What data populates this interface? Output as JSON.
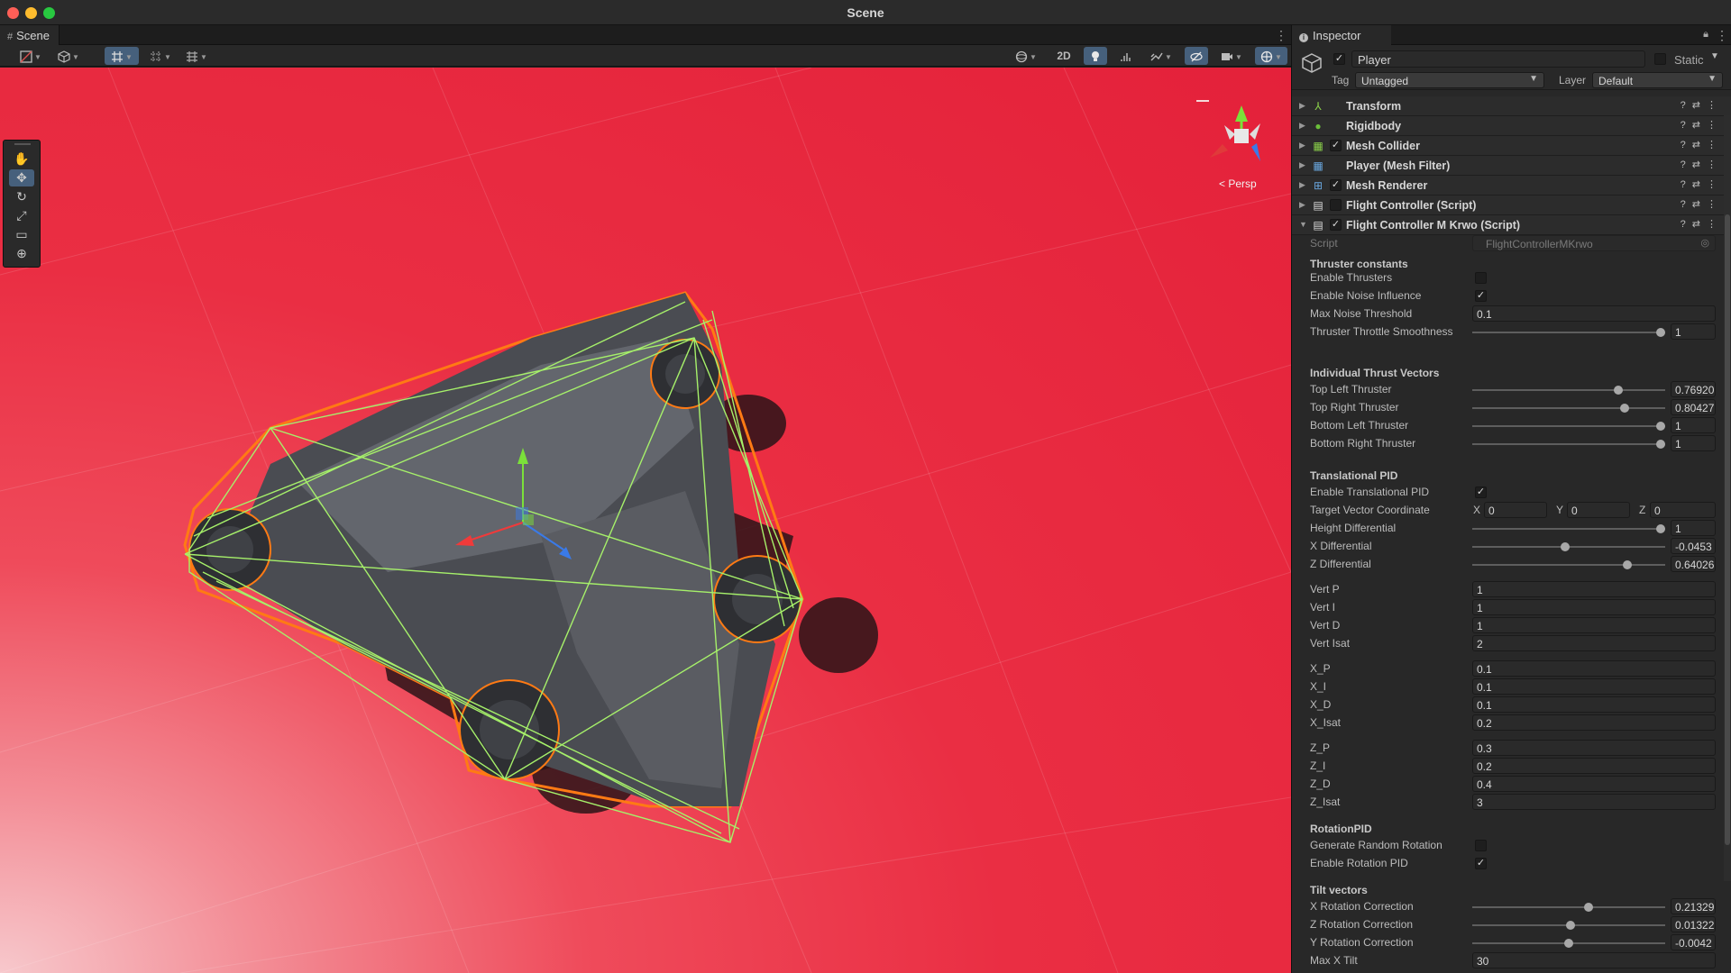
{
  "window": {
    "title": "Scene"
  },
  "scene": {
    "tab_label": "Scene",
    "toolbar": {
      "mode_2d": "2D"
    },
    "gizmo_label": "< Persp"
  },
  "inspector": {
    "tab_label": "Inspector",
    "object": {
      "name": "Player",
      "static_label": "Static",
      "tag_label": "Tag",
      "tag_value": "Untagged",
      "layer_label": "Layer",
      "layer_value": "Default"
    },
    "components": [
      {
        "name": "Transform",
        "icon": "transform-icon",
        "enabled": null
      },
      {
        "name": "Rigidbody",
        "icon": "rigidbody-icon",
        "enabled": null
      },
      {
        "name": "Mesh Collider",
        "icon": "mesh-collider-icon",
        "enabled": true
      },
      {
        "name": "Player (Mesh Filter)",
        "icon": "mesh-filter-icon",
        "enabled": null
      },
      {
        "name": "Mesh Renderer",
        "icon": "mesh-renderer-icon",
        "enabled": true
      },
      {
        "name": "Flight Controller (Script)",
        "icon": "script-icon",
        "enabled": false
      },
      {
        "name": "Flight Controller M Krwo (Script)",
        "icon": "script-icon",
        "enabled": true
      }
    ],
    "script": {
      "label": "Script",
      "value": "FlightControllerMKrwo"
    },
    "sections": {
      "thruster_constants": "Thruster constants",
      "individual_thrust": "Individual Thrust Vectors",
      "translational_pid": "Translational PID",
      "rotation_pid": "RotationPID",
      "tilt_vectors": "Tilt vectors"
    },
    "props": {
      "enable_thrusters": {
        "label": "Enable Thrusters",
        "checked": false
      },
      "enable_noise": {
        "label": "Enable Noise Influence",
        "checked": true
      },
      "max_noise": {
        "label": "Max Noise Threshold",
        "value": "0.1"
      },
      "throttle_smooth": {
        "label": "Thruster Throttle Smoothness",
        "value": "1",
        "fraction": 1.0
      },
      "top_left": {
        "label": "Top Left Thruster",
        "value": "0.76920",
        "fraction": 0.7692
      },
      "top_right": {
        "label": "Top Right Thruster",
        "value": "0.80427",
        "fraction": 0.8043
      },
      "bottom_left": {
        "label": "Bottom Left Thruster",
        "value": "1",
        "fraction": 1.0
      },
      "bottom_right": {
        "label": "Bottom Right Thruster",
        "value": "1",
        "fraction": 1.0
      },
      "enable_translational": {
        "label": "Enable Translational PID",
        "checked": true
      },
      "target_vector": {
        "label": "Target Vector Coordinate",
        "x_label": "X",
        "x": "0",
        "y_label": "Y",
        "y": "0",
        "z_label": "Z",
        "z": "0"
      },
      "height_diff": {
        "label": "Height Differential",
        "value": "1",
        "fraction": 1.0
      },
      "x_diff": {
        "label": "X Differential",
        "value": "-0.0453",
        "fraction": 0.48
      },
      "z_diff": {
        "label": "Z Differential",
        "value": "0.64026",
        "fraction": 0.82
      },
      "vert_p": {
        "label": "Vert P",
        "value": "1"
      },
      "vert_i": {
        "label": "Vert I",
        "value": "1"
      },
      "vert_d": {
        "label": "Vert D",
        "value": "1"
      },
      "vert_isat": {
        "label": "Vert Isat",
        "value": "2"
      },
      "x_p": {
        "label": "X_P",
        "value": "0.1"
      },
      "x_i": {
        "label": "X_I",
        "value": "0.1"
      },
      "x_d": {
        "label": "X_D",
        "value": "0.1"
      },
      "x_isat": {
        "label": "X_Isat",
        "value": "0.2"
      },
      "z_p": {
        "label": "Z_P",
        "value": "0.3"
      },
      "z_i": {
        "label": "Z_I",
        "value": "0.2"
      },
      "z_d": {
        "label": "Z_D",
        "value": "0.4"
      },
      "z_isat": {
        "label": "Z_Isat",
        "value": "3"
      },
      "gen_random_rot": {
        "label": "Generate Random Rotation",
        "checked": false
      },
      "enable_rot_pid": {
        "label": "Enable Rotation PID",
        "checked": true
      },
      "x_rot_corr": {
        "label": "X Rotation Correction",
        "value": "0.21329",
        "fraction": 0.61
      },
      "z_rot_corr": {
        "label": "Z Rotation Correction",
        "value": "0.01322",
        "fraction": 0.51
      },
      "y_rot_corr": {
        "label": "Y Rotation Correction",
        "value": "-0.0042",
        "fraction": 0.5
      },
      "max_x_tilt": {
        "label": "Max X Tilt",
        "value": "30"
      }
    }
  }
}
